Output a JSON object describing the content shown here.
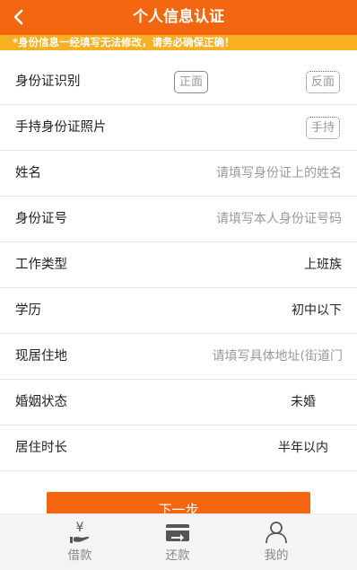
{
  "header": {
    "title": "个人信息认证",
    "back_icon": "chevron-left-icon"
  },
  "notice": "*身份信息一经填写无法修改，请务必确保正确！",
  "rows": [
    {
      "label": "身份证识别",
      "front_button": "正面",
      "back_button": "反面"
    },
    {
      "label": "手持身份证照片",
      "hold_button": "手持"
    },
    {
      "label": "姓名",
      "placeholder": "请填写身份证上的姓名"
    },
    {
      "label": "身份证号",
      "placeholder": "请填写本人身份证号码"
    },
    {
      "label": "工作类型",
      "value": "上班族"
    },
    {
      "label": "学历",
      "value": "初中以下"
    },
    {
      "label": "现居住地",
      "placeholder": "请填写具体地址(街道门"
    },
    {
      "label": "婚姻状态",
      "value": "未婚"
    },
    {
      "label": "居住时长",
      "value": "半年以内"
    }
  ],
  "next_button": "下一步",
  "tabbar": [
    {
      "label": "借款",
      "icon": "yen-hand-icon"
    },
    {
      "label": "还款",
      "icon": "card-arrow-icon"
    },
    {
      "label": "我的",
      "icon": "user-icon"
    }
  ],
  "colors": {
    "brand": "#f4650f",
    "notice_bg": "#f7b022",
    "tab_inactive": "#888888"
  }
}
